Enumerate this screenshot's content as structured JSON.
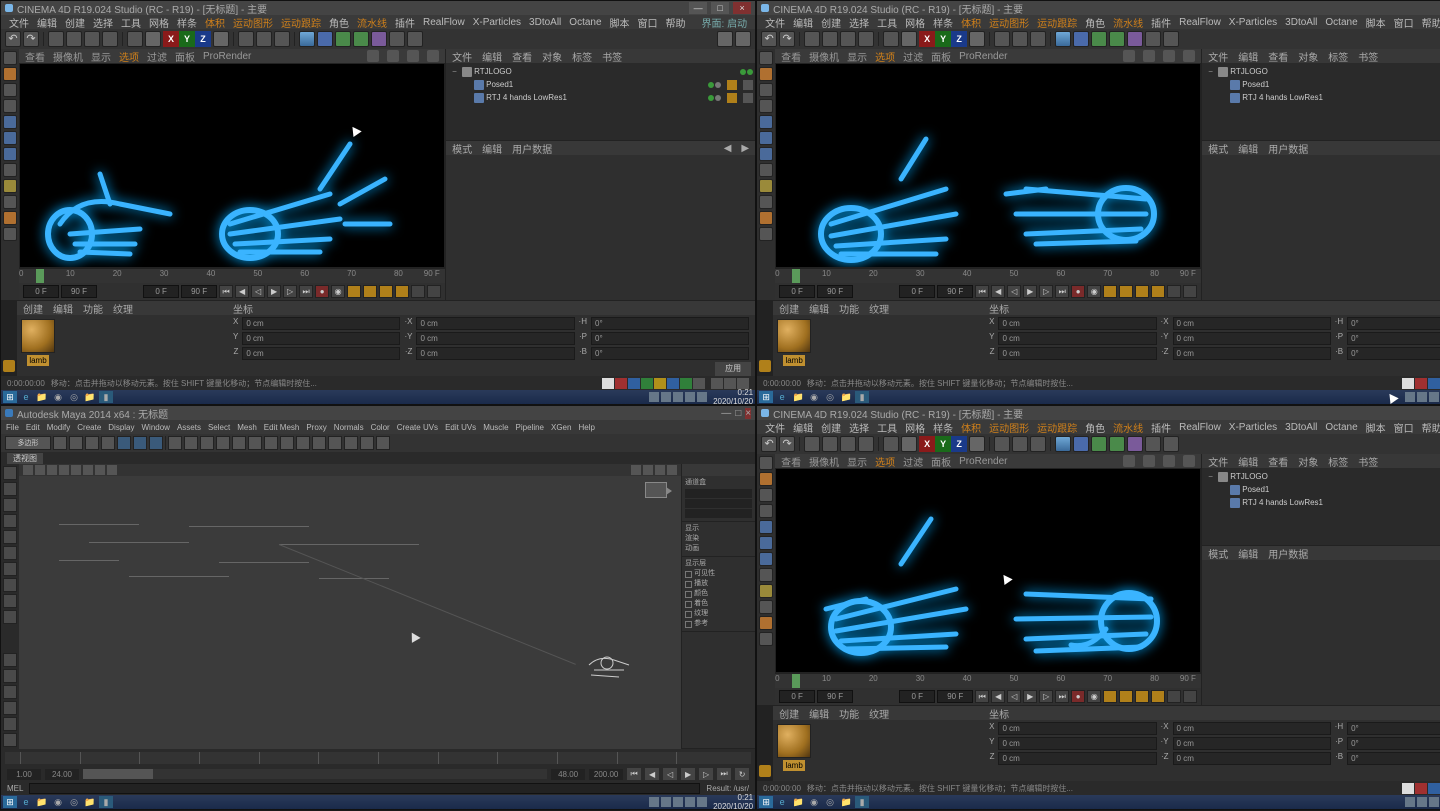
{
  "c4d": {
    "title": "CINEMA 4D R19.024 Studio (RC - R19) - [无标题] - 主要",
    "menus": [
      "文件",
      "编辑",
      "创建",
      "选择",
      "工具",
      "网格",
      "样条",
      "体积",
      "运动图形",
      "运动跟踪",
      "角色",
      "流水线",
      "插件",
      "RealFlow",
      "X-Particles",
      "3DtoAll",
      "Octane",
      "脚本",
      "窗口",
      "帮助"
    ],
    "layout_menu": "界面: 启动",
    "vp_tabs": [
      "查看",
      "摄像机",
      "显示",
      "选项",
      "过滤",
      "面板",
      "ProRender"
    ],
    "vp_selected_idx": 3,
    "timeline_ticks": [
      "0",
      "10",
      "20",
      "30",
      "40",
      "50",
      "60",
      "70",
      "80",
      "90 F"
    ],
    "time_start": "0 F",
    "time_cur": "0 F",
    "time_end": "90 F",
    "time_end2": "90 F",
    "obj_tabs": [
      "文件",
      "编辑",
      "查看",
      "对象",
      "标签",
      "书签"
    ],
    "objects": [
      {
        "name": "RTJLOGO",
        "depth": 0,
        "icon": "null",
        "exp": "−"
      },
      {
        "name": "Posed1",
        "depth": 1,
        "icon": "poly",
        "exp": ""
      },
      {
        "name": "RTJ 4 hands LowRes1",
        "depth": 1,
        "icon": "poly",
        "exp": ""
      }
    ],
    "attr_tabs": [
      "模式",
      "编辑",
      "用户数据"
    ],
    "mat_tabs": [
      "创建",
      "编辑",
      "功能",
      "纹理"
    ],
    "mat_name": "lamb",
    "coord_tabs": "坐标",
    "coord": {
      "X": "0 cm",
      "Y": "0 cm",
      "Z": "0 cm",
      "sX": "0 cm",
      "sY": "0 cm",
      "sZ": "0 cm",
      "H": "0°",
      "P": "0°",
      "B": "0°"
    },
    "apply": "应用",
    "status_time": "0:00:00:00",
    "status_hint": "移动：点击并拖动以移动元素。按住 SHIFT 键量化移动；节点编辑时按住...",
    "taskbar_time": "0:21\n2020/10/20"
  },
  "maya": {
    "title": "Autodesk Maya 2014 x64 : 无标题",
    "menus": [
      "File",
      "Edit",
      "Modify",
      "Create",
      "Display",
      "Window",
      "Assets",
      "Select",
      "Mesh",
      "Edit Mesh",
      "Proxy",
      "Normals",
      "Color",
      "Create UVs",
      "Edit UVs",
      "Muscle",
      "Pipeline",
      "XGen",
      "Help"
    ],
    "shelf_set": "多边形",
    "tab": "透视图",
    "right_panel": {
      "title": "通道盒",
      "sections": [
        "显示",
        "渲染",
        "动画"
      ],
      "layers_label": "显示层",
      "options": [
        "可见性",
        "播放",
        "颜色",
        "着色",
        "纹理",
        "参考"
      ]
    },
    "time_start": "1.00",
    "time_end": "24.00",
    "range_end": "48.00",
    "range_end2": "200.00",
    "cmd_label": "MEL",
    "status": "Result: /usr/"
  }
}
